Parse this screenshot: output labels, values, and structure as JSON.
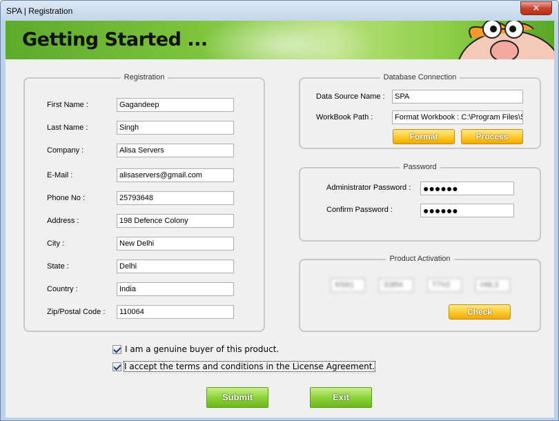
{
  "window": {
    "title": "SPA | Registration",
    "close_glyph": "✕"
  },
  "banner": {
    "title": "Getting Started ..."
  },
  "registration": {
    "title": "Registration",
    "fields": [
      {
        "label": "First Name :",
        "value": "Gagandeep"
      },
      {
        "label": "Last Name :",
        "value": "Singh"
      },
      {
        "label": "Company :",
        "value": "Alisa Servers"
      },
      {
        "label": "E-Mail :",
        "value": "alisaservers@gmail.com"
      },
      {
        "label": "Phone No :",
        "value": "25793648"
      },
      {
        "label": "Address :",
        "value": "198 Defence Colony"
      },
      {
        "label": "City :",
        "value": "New Delhi"
      },
      {
        "label": "State :",
        "value": "Delhi"
      },
      {
        "label": "Country :",
        "value": "India"
      },
      {
        "label": "Zip/Postal Code :",
        "value": "110064"
      }
    ]
  },
  "database": {
    "title": "Database Connection",
    "datasource_label": "Data Source Name :",
    "datasource_value": "SPA",
    "workbook_label": "WorkBook Path :",
    "workbook_value": "Format Workbook : C:\\Program Files\\SPA",
    "format_label": "Format",
    "process_label": "Process"
  },
  "password": {
    "title": "Password",
    "admin_label": "Administrator Password :",
    "admin_value": "●●●●●●",
    "confirm_label": "Confirm Password :",
    "confirm_value": "●●●●●●"
  },
  "activation": {
    "title": "Product Activation",
    "keys": [
      "K5A1",
      "S3R4",
      "T7V2",
      "H9L3"
    ],
    "check_label": "Check"
  },
  "checkboxes": {
    "genuine": {
      "label": "I am a genuine buyer of this product.",
      "checked": true
    },
    "terms": {
      "label": "I accept the terms and conditions in the License Agreement.",
      "checked": true
    }
  },
  "buttons": {
    "submit": "Submit",
    "exit": "Exit"
  },
  "colors": {
    "banner_green": "#7cc43c",
    "button_orange": "#ffcc33",
    "button_green": "#8fd23a"
  }
}
